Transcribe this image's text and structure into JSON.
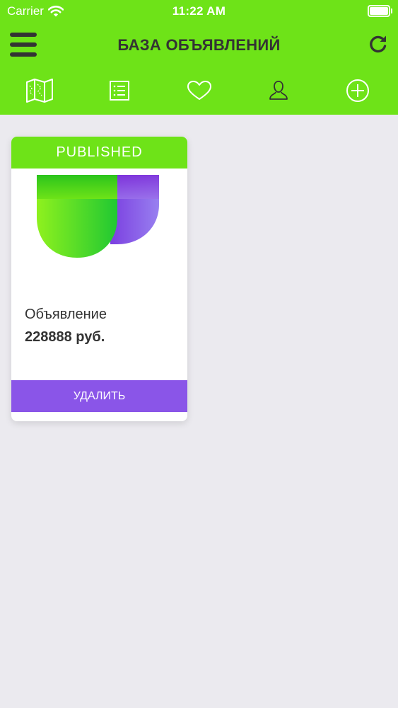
{
  "status_bar": {
    "carrier": "Carrier",
    "time": "11:22 AM",
    "icons": [
      "wifi-icon",
      "battery-icon"
    ]
  },
  "header": {
    "title": "БАЗА ОБЪЯВЛЕНИЙ",
    "left_icon": "menu-icon",
    "right_icon": "refresh-icon"
  },
  "tabs": [
    {
      "icon": "map-icon"
    },
    {
      "icon": "list-icon"
    },
    {
      "icon": "heart-icon"
    },
    {
      "icon": "user-icon"
    },
    {
      "icon": "add-icon"
    }
  ],
  "listings": [
    {
      "status": "PUBLISHED",
      "title": "Объявление",
      "price": "228888 руб.",
      "delete_label": "УДАЛИТЬ"
    }
  ],
  "colors": {
    "accent_green": "#6ee318",
    "header_text": "#333333",
    "delete_purple": "#8a55e8",
    "background": "#ebeaef"
  }
}
